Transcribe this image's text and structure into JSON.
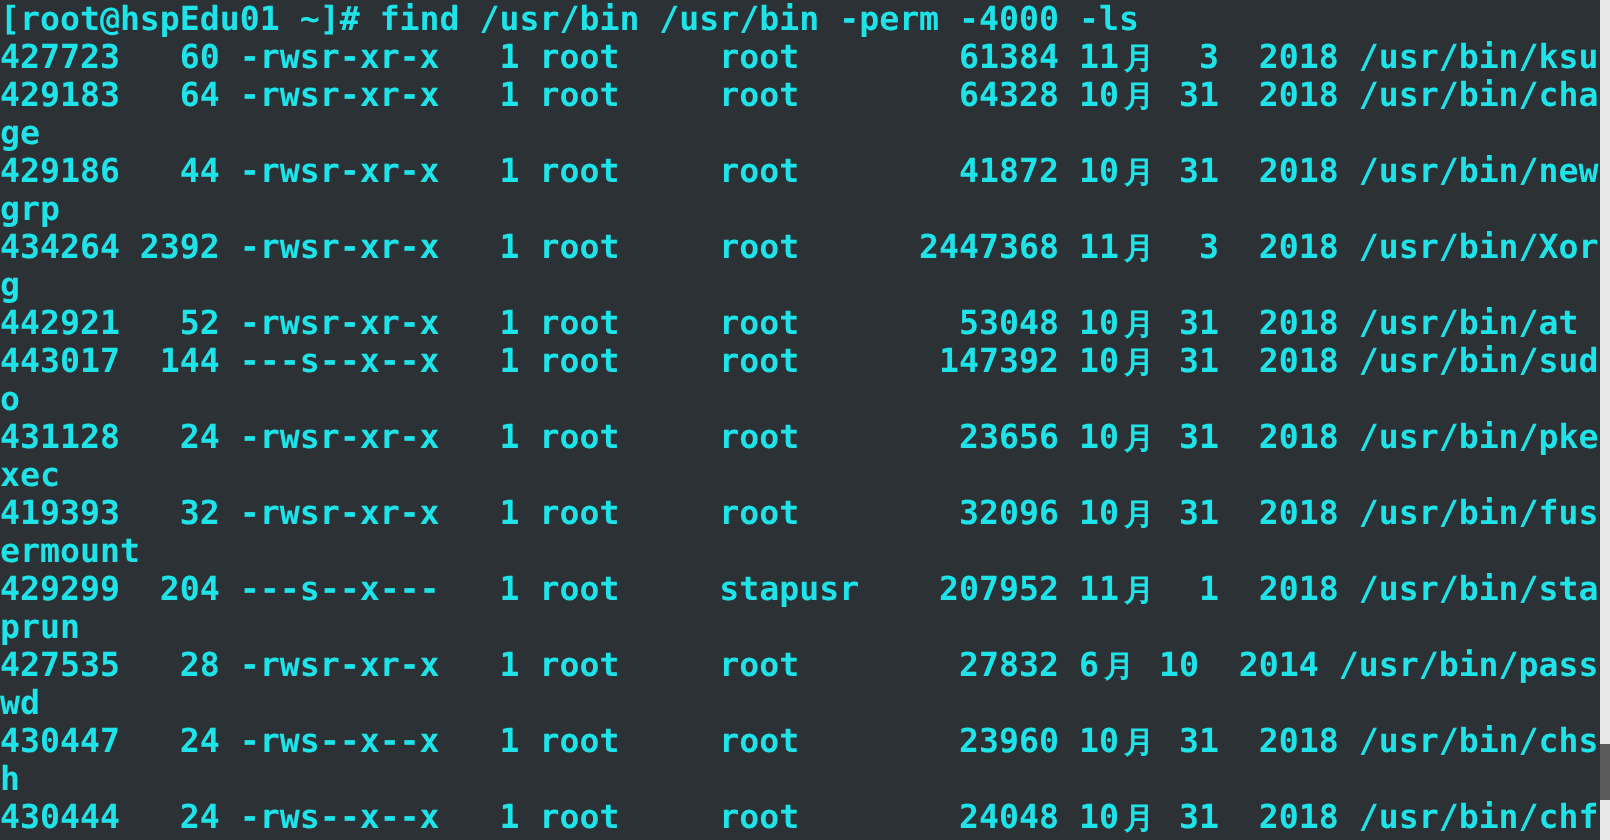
{
  "terminal": {
    "lines": [
      "[root@hspEdu01 ~]# find /usr/bin /usr/bin -perm -4000 -ls",
      "427723   60 -rwsr-xr-x   1 root     root        61384 11月  3  2018 /usr/bin/ksu",
      "429183   64 -rwsr-xr-x   1 root     root        64328 10月 31  2018 /usr/bin/cha",
      "ge",
      "429186   44 -rwsr-xr-x   1 root     root        41872 10月 31  2018 /usr/bin/new",
      "grp",
      "434264 2392 -rwsr-xr-x   1 root     root      2447368 11月  3  2018 /usr/bin/Xor",
      "g",
      "442921   52 -rwsr-xr-x   1 root     root        53048 10月 31  2018 /usr/bin/at",
      "443017  144 ---s--x--x   1 root     root       147392 10月 31  2018 /usr/bin/sud",
      "o",
      "431128   24 -rwsr-xr-x   1 root     root        23656 10月 31  2018 /usr/bin/pke",
      "xec",
      "419393   32 -rwsr-xr-x   1 root     root        32096 10月 31  2018 /usr/bin/fus",
      "ermount",
      "429299  204 ---s--x---   1 root     stapusr    207952 11月  1  2018 /usr/bin/sta",
      "prun",
      "427535   28 -rwsr-xr-x   1 root     root        27832 6月 10  2014 /usr/bin/pass",
      "wd",
      "430447   24 -rws--x--x   1 root     root        23960 10月 31  2018 /usr/bin/chs",
      "h",
      "430444   24 -rws--x--x   1 root     root        24048 10月 31  2018 /usr/bin/chf"
    ]
  }
}
